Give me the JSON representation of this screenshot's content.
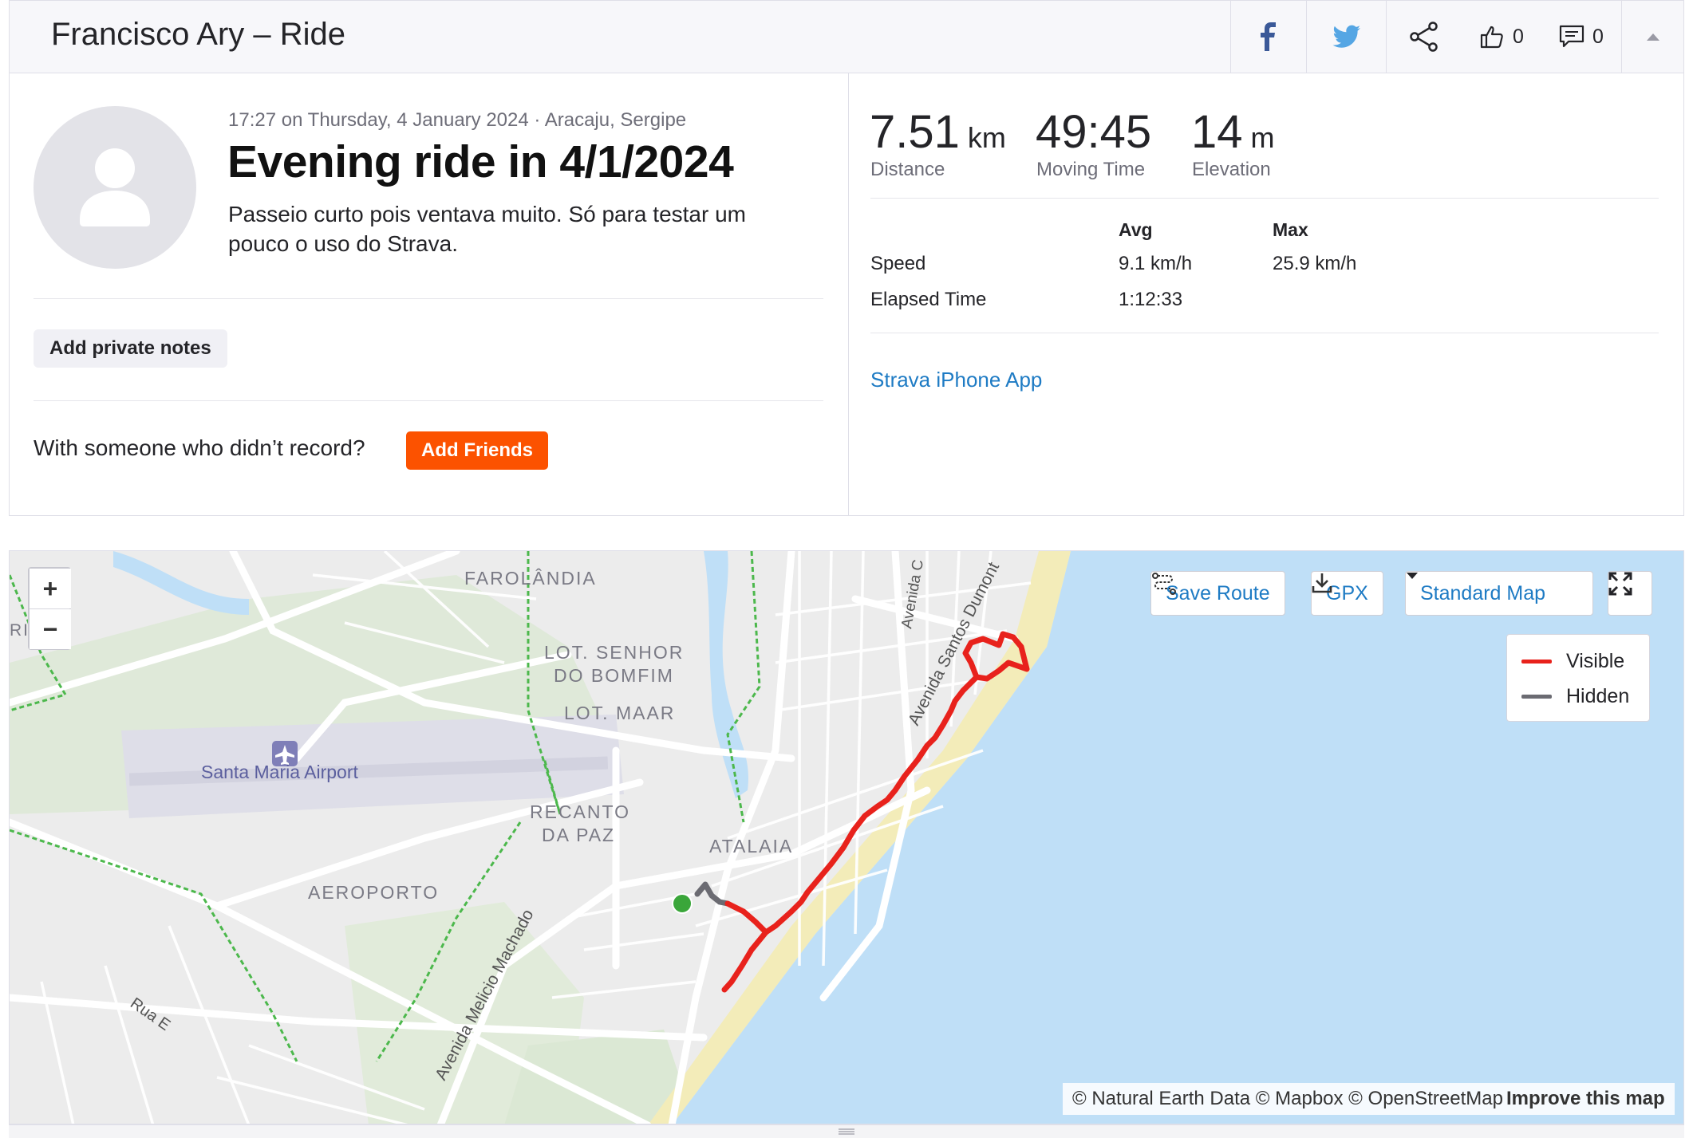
{
  "header": {
    "title": "Francisco Ary – Ride",
    "kudos_count": "0",
    "comment_count": "0",
    "icons": [
      "facebook-icon",
      "twitter-icon",
      "share-icon",
      "thumbs-up-icon",
      "comment-icon",
      "collapse-icon"
    ]
  },
  "activity": {
    "meta": "17:27 on Thursday, 4 January 2024 · Aracaju, Sergipe",
    "title": "Evening ride in 4/1/2024",
    "description": "Passeio curto pois ventava muito. Só para testar um pouco o uso do Strava.",
    "notes_button": "Add private notes",
    "someone_text": "With someone who didn’t record?",
    "add_friends_button": "Add Friends"
  },
  "stats": {
    "distance": {
      "value": "7.51",
      "unit": "km",
      "label": "Distance"
    },
    "moving_time": {
      "value": "49:45",
      "label": "Moving Time"
    },
    "elevation": {
      "value": "14",
      "unit": "m",
      "label": "Elevation"
    },
    "table": {
      "headers": [
        "Avg",
        "Max"
      ],
      "rows": [
        {
          "label": "Speed",
          "avg": "9.1 km/h",
          "max": "25.9 km/h"
        },
        {
          "label": "Elapsed Time",
          "avg": "1:12:33",
          "max": ""
        }
      ]
    },
    "device": "Strava iPhone App"
  },
  "map": {
    "zoom_in": "+",
    "zoom_out": "−",
    "save_route": "Save Route",
    "gpx": "GPX",
    "map_style": "Standard Map",
    "legend": {
      "visible": "Visible",
      "hidden": "Hidden"
    },
    "labels": {
      "farolandia": "FAROLÂNDIA",
      "senhor_bomfim_1": "LOT. SENHOR",
      "senhor_bomfim_2": "DO BOMFIM",
      "lot_maar": "LOT. MAAR",
      "airport": "Santa Maria Airport",
      "recanto_1": "RECANTO",
      "recanto_2": "DA PAZ",
      "atalaia": "ATALAIA",
      "aeroporto": "AEROPORTO",
      "av_santos": "Avenida Santos Dumont",
      "av_c": "Avenida C",
      "av_melicio": "Avenida Melicio Machado",
      "rua_e": "Rua E",
      "ri": "RI"
    },
    "attribution": "© Natural Earth Data © Mapbox © OpenStreetMap",
    "improve": "Improve this map",
    "colors": {
      "visible": "#e8221c",
      "hidden": "#6b6b72",
      "start": "#3aa63a",
      "water": "#bfdff7",
      "sand": "#f3ecb9"
    }
  }
}
